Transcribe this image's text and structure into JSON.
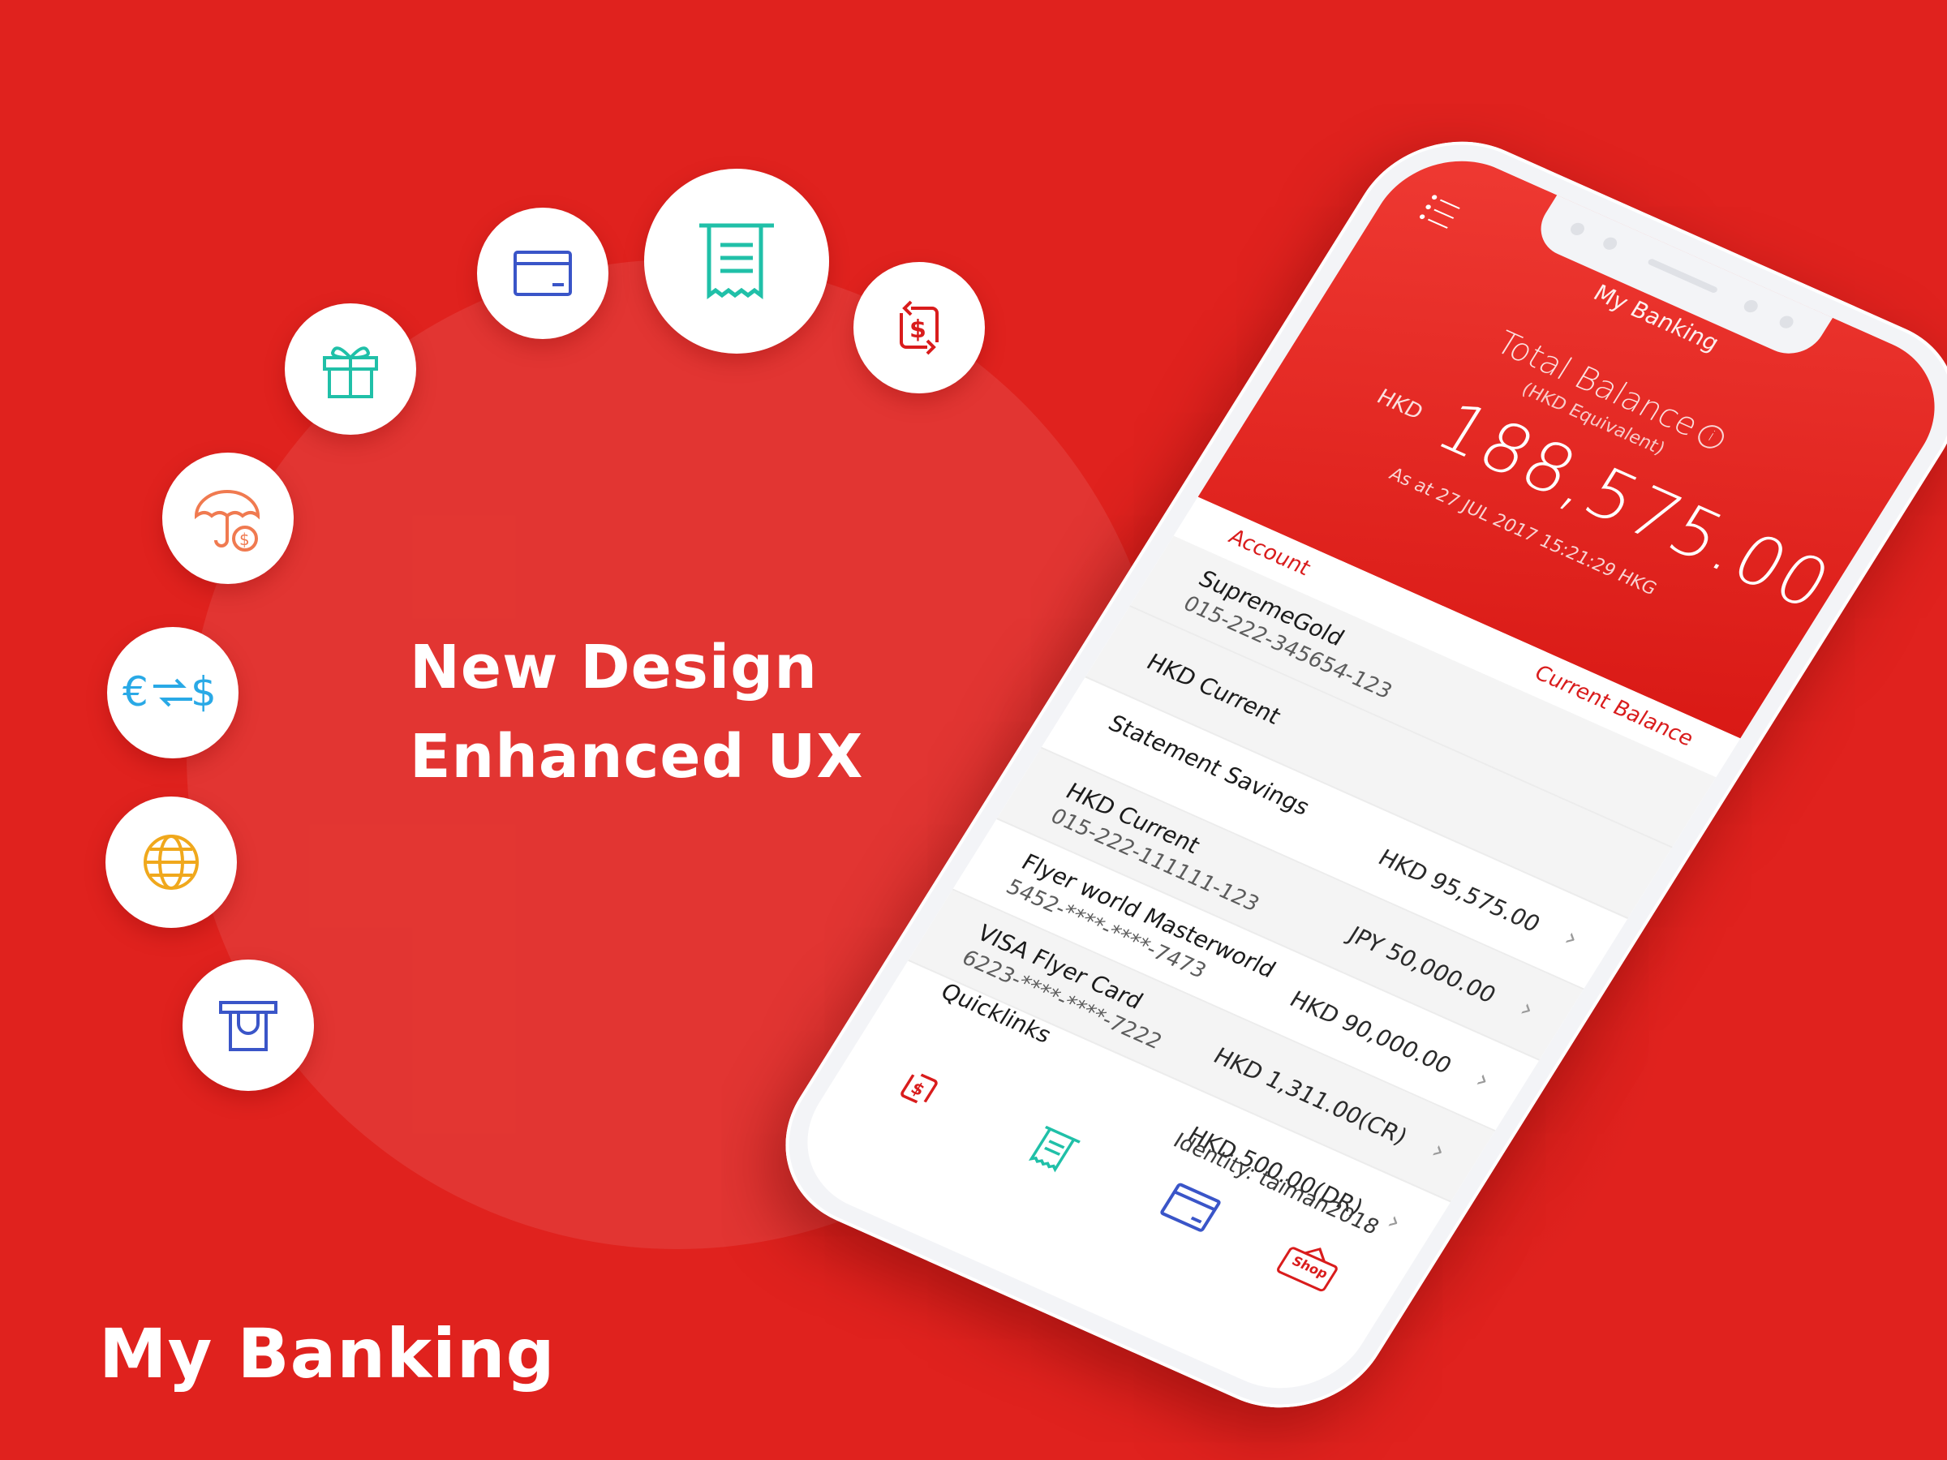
{
  "headline": {
    "line1": "New Design",
    "line2": "Enhanced UX"
  },
  "brand": "My Banking",
  "feature_icons": [
    "atm-icon",
    "globe-icon",
    "currency-exchange-icon",
    "insurance-umbrella-icon",
    "gift-icon",
    "card-icon",
    "receipt-icon",
    "transfer-icon"
  ],
  "phone": {
    "title": "My Banking",
    "total_balance": {
      "label": "Total Balance",
      "info": "i",
      "subtitle": "(HKD Equivalent)",
      "currency": "HKD",
      "amount": "188,575.00",
      "as_at": "As at 27 JUL 2017 15:21:29 HKG"
    },
    "section": {
      "account_label": "Account",
      "balance_label": "Current Balance"
    },
    "accounts": [
      {
        "name": "SupremeGold",
        "number": "015-222-345654-123",
        "balance": ""
      },
      {
        "name": "HKD Current",
        "number": "",
        "balance": ""
      },
      {
        "name": "Statement Savings",
        "number": "",
        "balance": "HKD 95,575.00"
      },
      {
        "name": "HKD Current",
        "number": "015-222-111111-123",
        "balance": "JPY 50,000.00"
      },
      {
        "name": "Flyer world Masterworld",
        "number": "5452-****-****-7473",
        "balance": "HKD 90,000.00"
      },
      {
        "name": "VISA Flyer Card",
        "number": "6223-****-****-7222",
        "balance": "HKD 1,311.00(CR)"
      },
      {
        "name": "",
        "number": "",
        "balance": "HKD 500.00(DR)"
      }
    ],
    "quicklinks_label": "Quicklinks",
    "identity": "Identity: taiman2018",
    "tab_shop_label": "Shop",
    "colors": {
      "brand_red": "#e0221e",
      "accent_red": "#d91c1c",
      "teal": "#20c0a8",
      "blue": "#3a55c8",
      "orange": "#f07a50",
      "sky": "#29a9e6",
      "gold": "#f0a81c"
    }
  }
}
